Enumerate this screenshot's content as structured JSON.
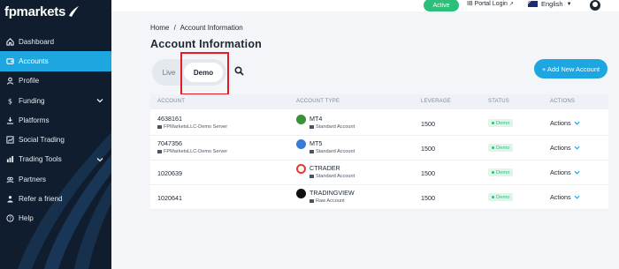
{
  "brand": {
    "name": "fpmarkets"
  },
  "topbar": {
    "status": "Active",
    "ib_portal": "IB Portal Login",
    "language": "English"
  },
  "sidebar": {
    "items": [
      {
        "label": "Dashboard",
        "icon": "home-icon"
      },
      {
        "label": "Accounts",
        "icon": "wallet-icon",
        "active": true
      },
      {
        "label": "Profile",
        "icon": "user-icon"
      },
      {
        "label": "Funding",
        "icon": "dollar-icon",
        "expandable": true
      },
      {
        "label": "Platforms",
        "icon": "download-icon"
      },
      {
        "label": "Social Trading",
        "icon": "chart-icon"
      },
      {
        "label": "Trading Tools",
        "icon": "tools-icon",
        "expandable": true
      },
      {
        "label": "Partners",
        "icon": "partners-icon"
      },
      {
        "label": "Refer a friend",
        "icon": "people-icon"
      },
      {
        "label": "Help",
        "icon": "help-icon"
      }
    ]
  },
  "breadcrumb": {
    "home": "Home",
    "separator": "/",
    "current": "Account Information"
  },
  "page": {
    "title": "Account Information"
  },
  "tabs": {
    "live": "Live",
    "demo": "Demo",
    "selected": "Demo"
  },
  "add_account": "+ Add New Account",
  "table": {
    "headers": [
      "ACCOUNT",
      "ACCOUNT TYPE",
      "LEVERAGE",
      "STATUS",
      "ACTIONS"
    ],
    "rows": [
      {
        "account": "4638161",
        "server": "FPMarketsLLC-Demo Server",
        "platform": "MT4",
        "account_type": "Standard Account",
        "leverage": "1500",
        "status": "Demo",
        "actions": "Actions",
        "logo_color": "#3a8f3a"
      },
      {
        "account": "7047356",
        "server": "FPMarketsLLC-Demo Server",
        "platform": "MT5",
        "account_type": "Standard Account",
        "leverage": "1500",
        "status": "Demo",
        "actions": "Actions",
        "logo_color": "#3a7bd5"
      },
      {
        "account": "1020639",
        "server": "",
        "platform": "CTRADER",
        "account_type": "Standard Account",
        "leverage": "1500",
        "status": "Demo",
        "actions": "Actions",
        "logo_color": "#e53935"
      },
      {
        "account": "1020641",
        "server": "",
        "platform": "TRADINGVIEW",
        "account_type": "Raw Account",
        "leverage": "1500",
        "status": "Demo",
        "actions": "Actions",
        "logo_color": "#111111"
      }
    ]
  },
  "colors": {
    "accent": "#1da6e0",
    "sidebar_bg": "#0f1d2e",
    "active_green": "#2bbf7a",
    "highlight_red": "#e81b24"
  }
}
